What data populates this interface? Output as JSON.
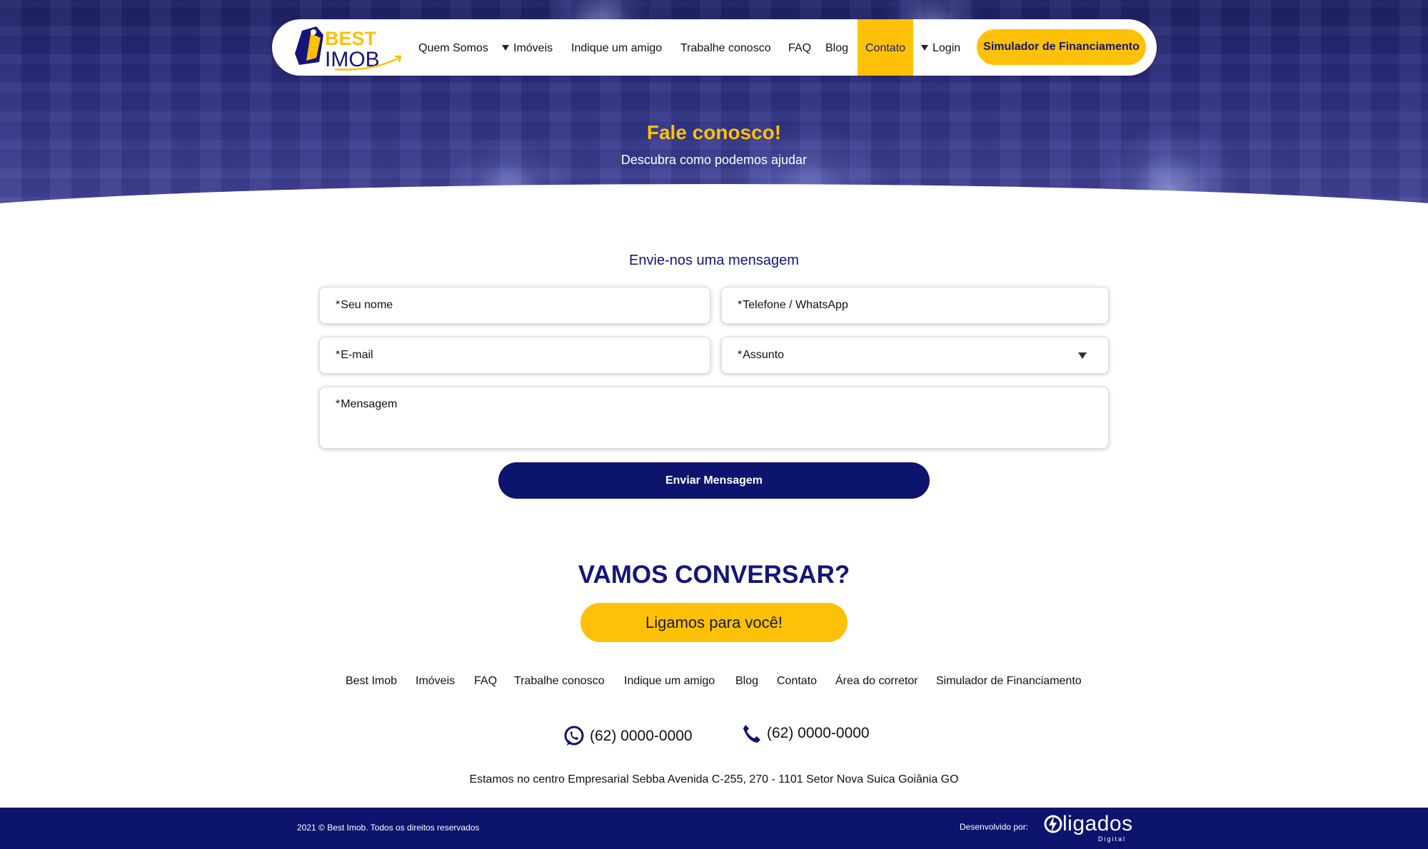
{
  "nav": {
    "items": [
      {
        "label": "Quem Somos",
        "has_caret": false
      },
      {
        "label": "Imóveis",
        "has_caret": true
      },
      {
        "label": "Indique um amigo",
        "has_caret": false
      },
      {
        "label": "Trabalhe conosco",
        "has_caret": false
      },
      {
        "label": "FAQ",
        "has_caret": false
      },
      {
        "label": "Blog",
        "has_caret": false
      },
      {
        "label": "Contato",
        "has_caret": false,
        "active": true
      },
      {
        "label": "Login",
        "has_caret": true
      }
    ],
    "cta_label": "Simulador de Financiamento",
    "logo": {
      "line1": "BEST",
      "line2": "IMOB"
    }
  },
  "hero": {
    "title": "Fale conosco!",
    "subtitle": "Descubra como podemos ajudar"
  },
  "form": {
    "title": "Envie-nos uma mensagem",
    "fields": {
      "name": "Seu nome",
      "phone": "Telefone / WhatsApp",
      "email": "E-mail",
      "subject": "Assunto",
      "message": "Mensagem"
    },
    "required_marker": "*",
    "submit_label": "Enviar Mensagem"
  },
  "cta": {
    "title": "VAMOS CONVERSAR?",
    "button_label": "Ligamos para você!"
  },
  "footer": {
    "links": [
      "Best Imob",
      "Imóveis",
      "FAQ",
      "Trabalhe conosco",
      "Indique um amigo",
      "Blog",
      "Contato",
      "Área do corretor",
      "Simulador de Financiamento"
    ],
    "whatsapp": "(62) 0000-0000",
    "phone": "(62) 0000-0000",
    "address": "Estamos no centro Empresarial Sebba Avenida C-255, 270 - 1101 Setor Nova Suica Goiânia GO",
    "copyright": "2021 © Best Imob. Todos os direitos reservados",
    "developed_by_label": "Desenvolvido por:",
    "developer_logo": {
      "name": "ligados",
      "sub": "Digital"
    }
  },
  "colors": {
    "navy": "#0d146e",
    "yellow": "#ffc107",
    "hero_blue": "#2c2f82"
  },
  "icons": {
    "whatsapp": "whatsapp-icon",
    "phone": "phone-icon",
    "select": "chevron-down-icon"
  }
}
